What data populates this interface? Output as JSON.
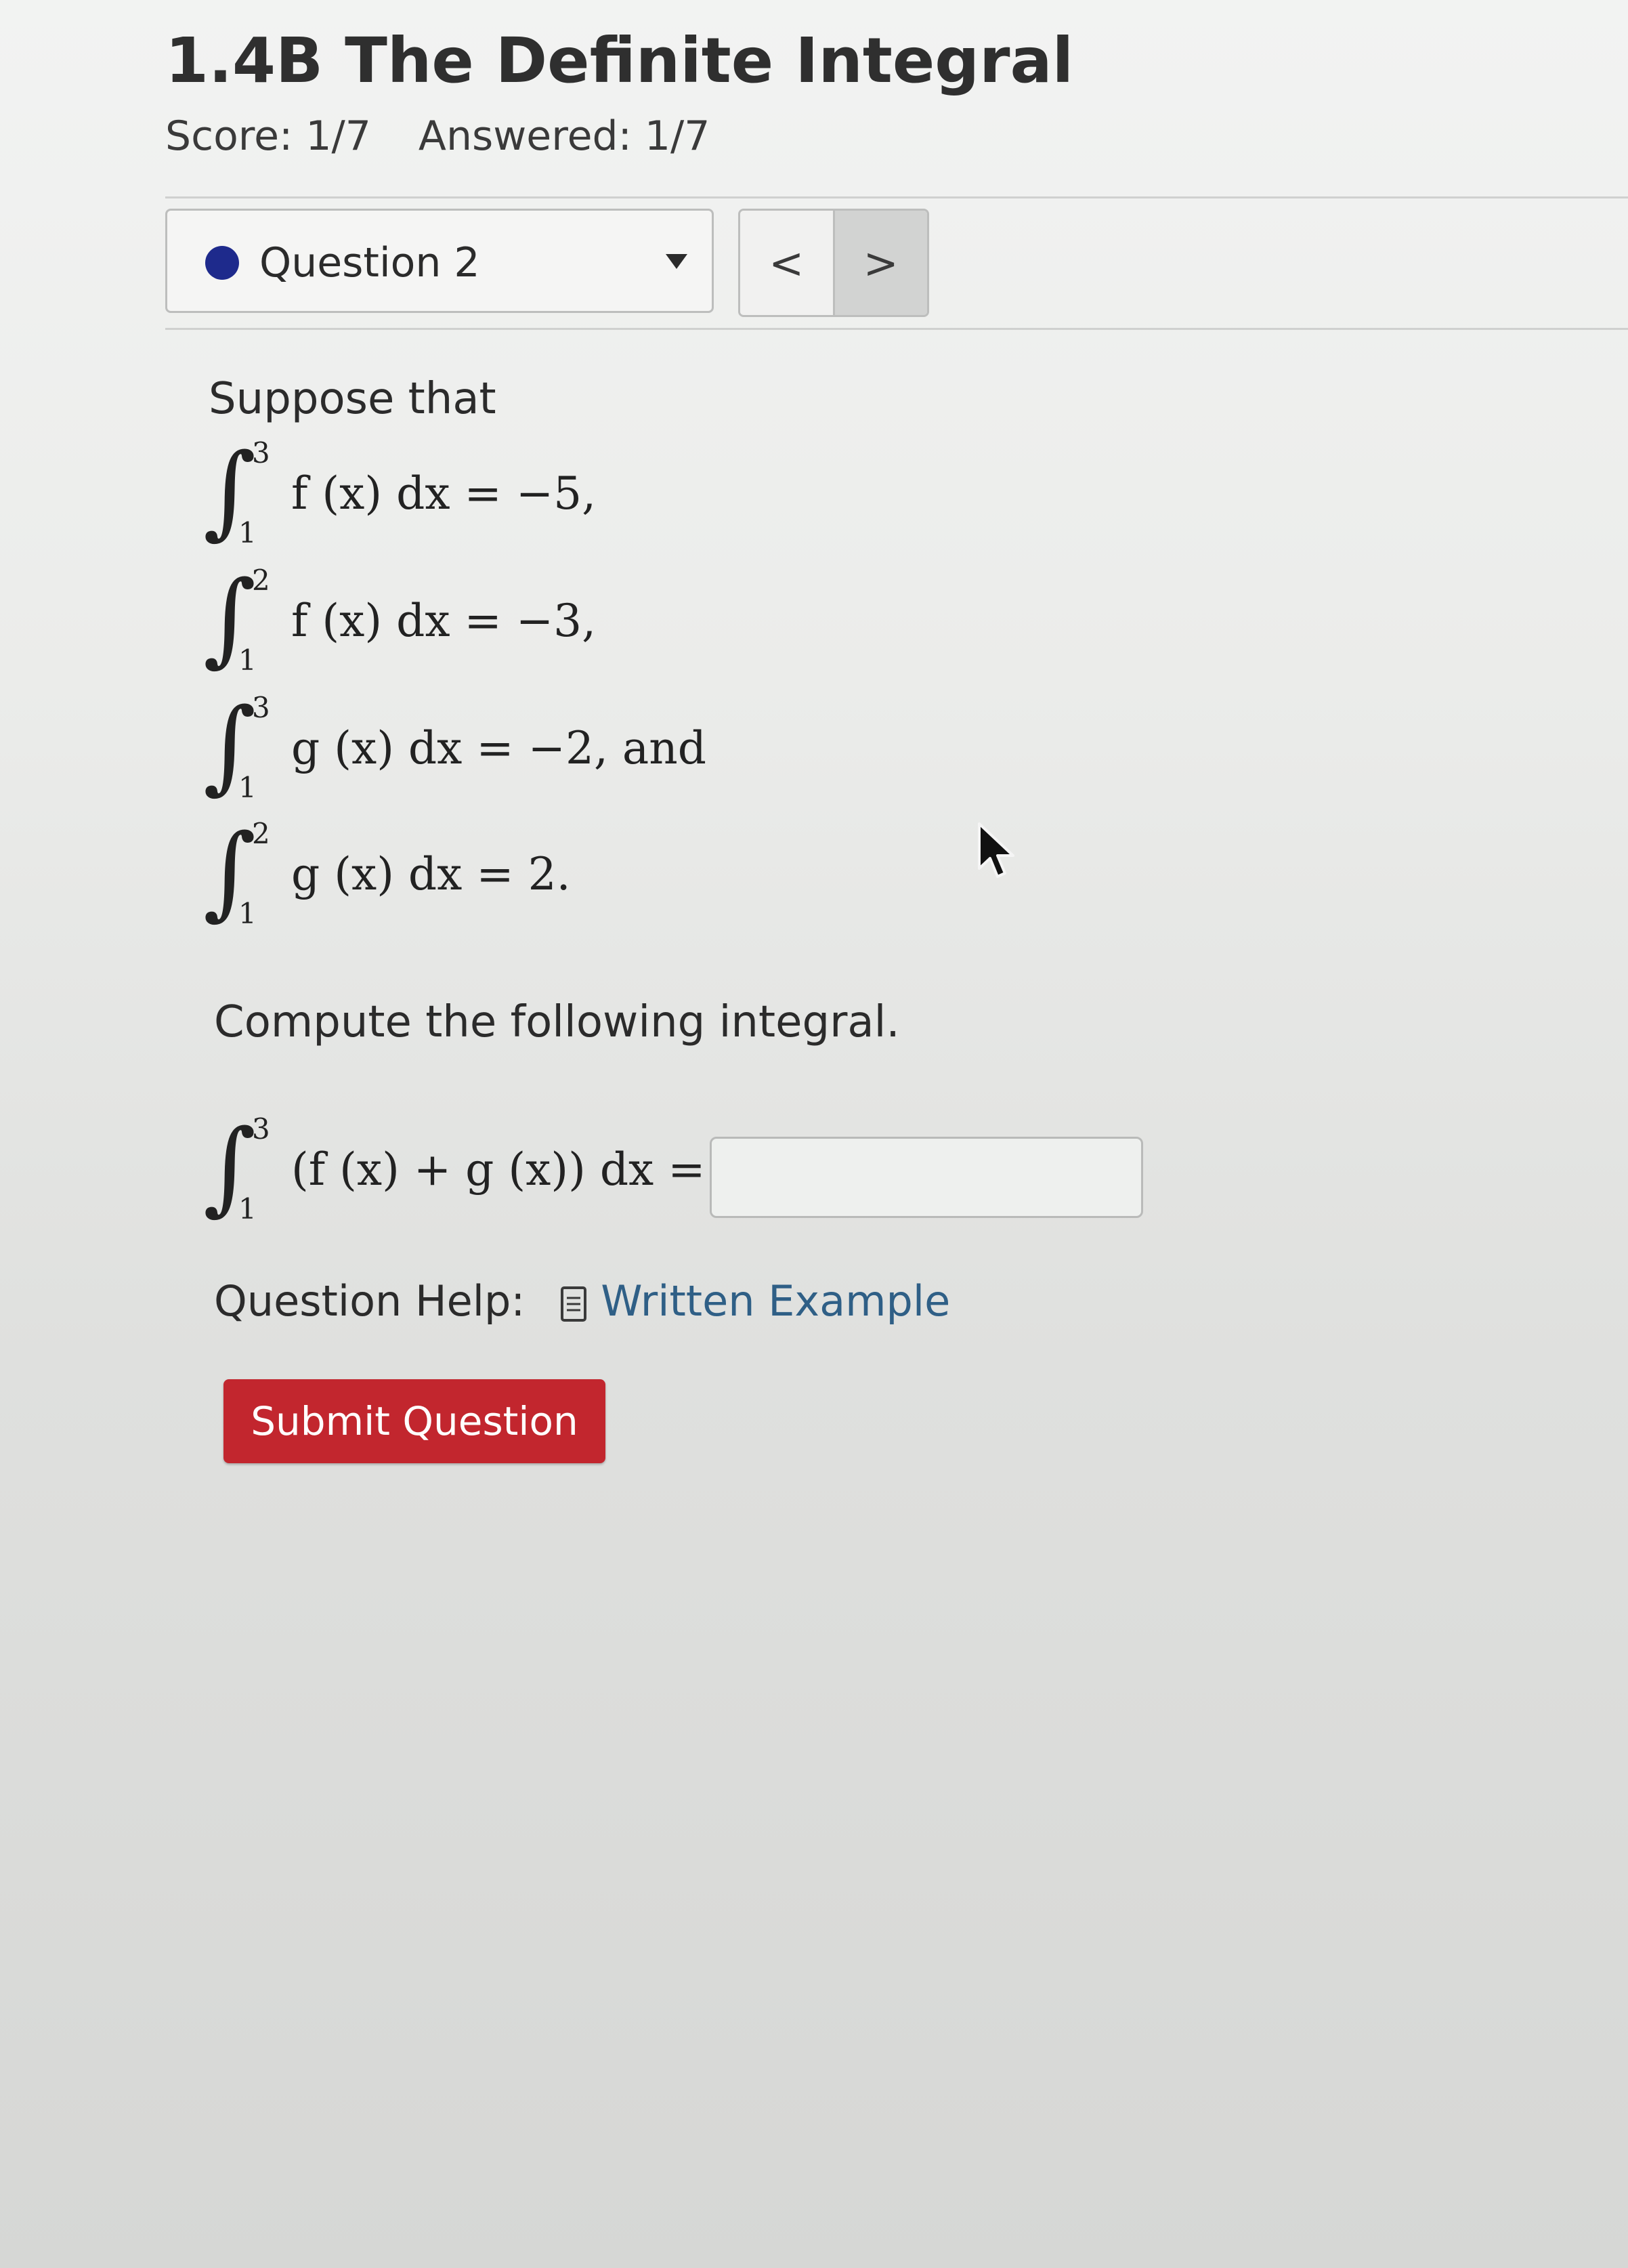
{
  "header": {
    "title": "1.4B The Definite Integral",
    "score": "Score: 1/7",
    "answered": "Answered: 1/7"
  },
  "question_nav": {
    "selected": "Question 2",
    "prev_label": "<",
    "next_label": ">"
  },
  "problem": {
    "intro": "Suppose that",
    "givens": [
      {
        "upper": "3",
        "lower": "1",
        "expr": "f (x) dx = −5,"
      },
      {
        "upper": "2",
        "lower": "1",
        "expr": "f (x) dx = −3,"
      },
      {
        "upper": "3",
        "lower": "1",
        "expr": "g (x) dx = −2, and"
      },
      {
        "upper": "2",
        "lower": "1",
        "expr": "g (x) dx = 2."
      }
    ],
    "prompt": "Compute the following integral.",
    "target": {
      "upper": "3",
      "lower": "1",
      "expr": "(f (x) + g (x)) dx ="
    },
    "answer_value": ""
  },
  "help": {
    "label": "Question Help:",
    "link": "Written Example"
  },
  "submit_label": "Submit Question",
  "colors": {
    "submit": "#c2262e",
    "link": "#2f5f86",
    "status_dot": "#1e2a8c"
  }
}
